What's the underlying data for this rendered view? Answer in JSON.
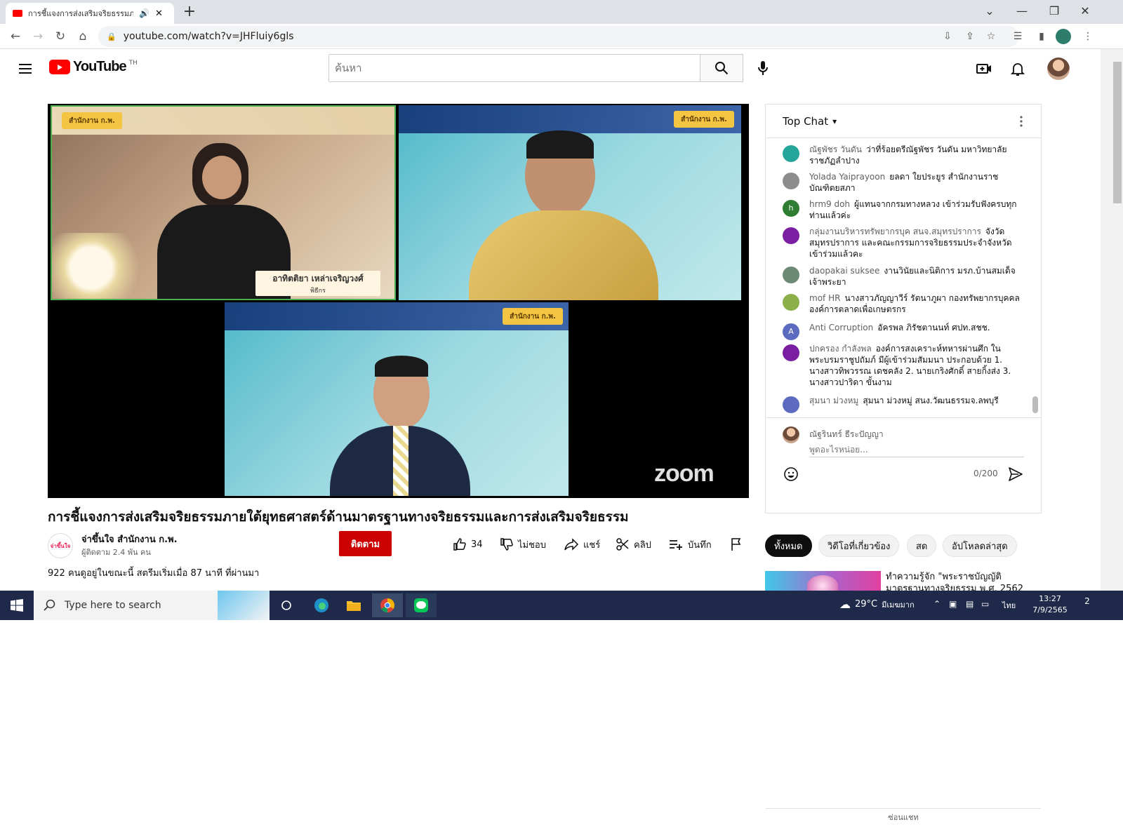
{
  "browser": {
    "tab_title": "การชี้แจงการส่งเสริมจริยธรรมภายใ",
    "new_tab": "+",
    "url": "youtube.com/watch?v=JHFluiy6gls"
  },
  "yt": {
    "logo_text": "YouTube",
    "country": "TH",
    "search_placeholder": "ค้นหา"
  },
  "video": {
    "tile1_banner_logo": "สำนักงาน ก.พ.",
    "tile1_name": "อาทิตติยา เหล่าเจริญวงศ์",
    "tile1_role": "พิธีกร",
    "tile2_banner_logo": "สำนักงาน ก.พ.",
    "tile3_banner_logo": "สำนักงาน ก.พ.",
    "zoom": "zoom",
    "title": "การชี้แจงการส่งเสริมจริยธรรมภายใต้ยุทธศาสตร์ด้านมาตรฐานทางจริยธรรมและการส่งเสริมจริยธรรม",
    "channel_name": "จ่าขึ้นใจ สำนักงาน ก.พ.",
    "channel_avatar_text": "จ่าขึ้นใจ",
    "subscribers": "ผู้ติดตาม 2.4 พัน คน",
    "subscribe_label": "ติดตาม",
    "likes": "34",
    "dislike_label": "ไม่ชอบ",
    "share_label": "แชร์",
    "clip_label": "คลิป",
    "save_label": "บันทึก",
    "view_info": "922 คนดูอยู่ในขณะนี้  สตรีมเริ่มเมื่อ 87 นาที ที่ผ่านมา"
  },
  "chat": {
    "header": "Top Chat",
    "messages": [
      {
        "author": "ณัฐพัชร วันดัน",
        "text": "ว่าที่ร้อยตรีณัฐพัชร วันดัน มหาวิทยาลัยราชภัฏลำปาง",
        "avatar_color": "#26a69a",
        "initial": ""
      },
      {
        "author": "Yolada Yaiprayoon",
        "text": "ยลดา ใยประยูร สำนักงานราชบัณฑิตยสภา",
        "avatar_color": "#8d8d8d",
        "initial": ""
      },
      {
        "author": "hrm9 doh",
        "text": "ผู้แทนจากกรมทางหลวง เข้าร่วมรับฟังครบทุกท่านแล้วค่ะ",
        "avatar_color": "#2e7d32",
        "initial": "h"
      },
      {
        "author": "กลุ่มงานบริหารทรัพยากรบุค สนจ.สมุทรปราการ",
        "text": "จังวัดสมุทรปราการ และคณะกรรมการจริยธรรมประจำจังหวัดเข้าร่วมแล้วคะ",
        "avatar_color": "#7b1fa2",
        "initial": ""
      },
      {
        "author": "daopakai suksee",
        "text": "งานวินัยและนิติการ มรภ.บ้านสมเด็จเจ้าพระยา",
        "avatar_color": "#6d8b74",
        "initial": ""
      },
      {
        "author": "mof HR",
        "text": "นางสาวภัญญาวีร์ รัตนาภูผา กองทรัพยากรบุคคล องค์การตลาดเพื่อเกษตรกร",
        "avatar_color": "#8bb04a",
        "initial": ""
      },
      {
        "author": "Anti Corruption",
        "text": "อัครพล ภิรัชตานนท์ ศปท.สชช.",
        "avatar_color": "#5c6bc0",
        "initial": "A"
      },
      {
        "author": "ปกครอง กำลังพล",
        "text": "องค์การสงเคราะห์ทหารผ่านศึก ในพระบรมราชูปถัมภ์ มีผู้เข้าร่วมสัมมนา ประกอบด้วย 1. นางสาวทิพวรรณ เดชคลัง 2. นายเกริงศักดิ์ สายกิ้งส่ง 3. นางสาวปาริดา ขั้นงาม",
        "avatar_color": "#7b1fa2",
        "initial": ""
      },
      {
        "author": "สุมนา ม่วงหมู",
        "text": "สุมนา ม่วงหมู่ สนง.วัฒนธรรมจ.ลพบุรี",
        "avatar_color": "#5c6bc0",
        "initial": ""
      }
    ],
    "my_name": "ณัฐรินทร์ ธีระปัญญา",
    "input_placeholder": "พูดอะไรหน่อย...",
    "counter": "0/200",
    "hide_label": "ซ่อนแชท"
  },
  "chips": [
    "ทั้งหมด",
    "วิดีโอที่เกี่ยวข้อง",
    "สด",
    "อัปโหลดล่าสุด"
  ],
  "recommended": {
    "title": "ทำความรู้จัก \"พระราชบัญญัติมาตรฐานทางจริยธรรม พ.ศ. 2562"
  },
  "taskbar": {
    "search_placeholder": "Type here to search",
    "temperature": "29°C",
    "weather_text": "มีเมฆมาก",
    "lang": "ไทย",
    "time": "13:27",
    "date": "7/9/2565",
    "notifications": "2"
  },
  "colors": {
    "yt_red": "#ff0000",
    "subscribe_red": "#cc0000",
    "taskbar": "#1f2a4a"
  }
}
